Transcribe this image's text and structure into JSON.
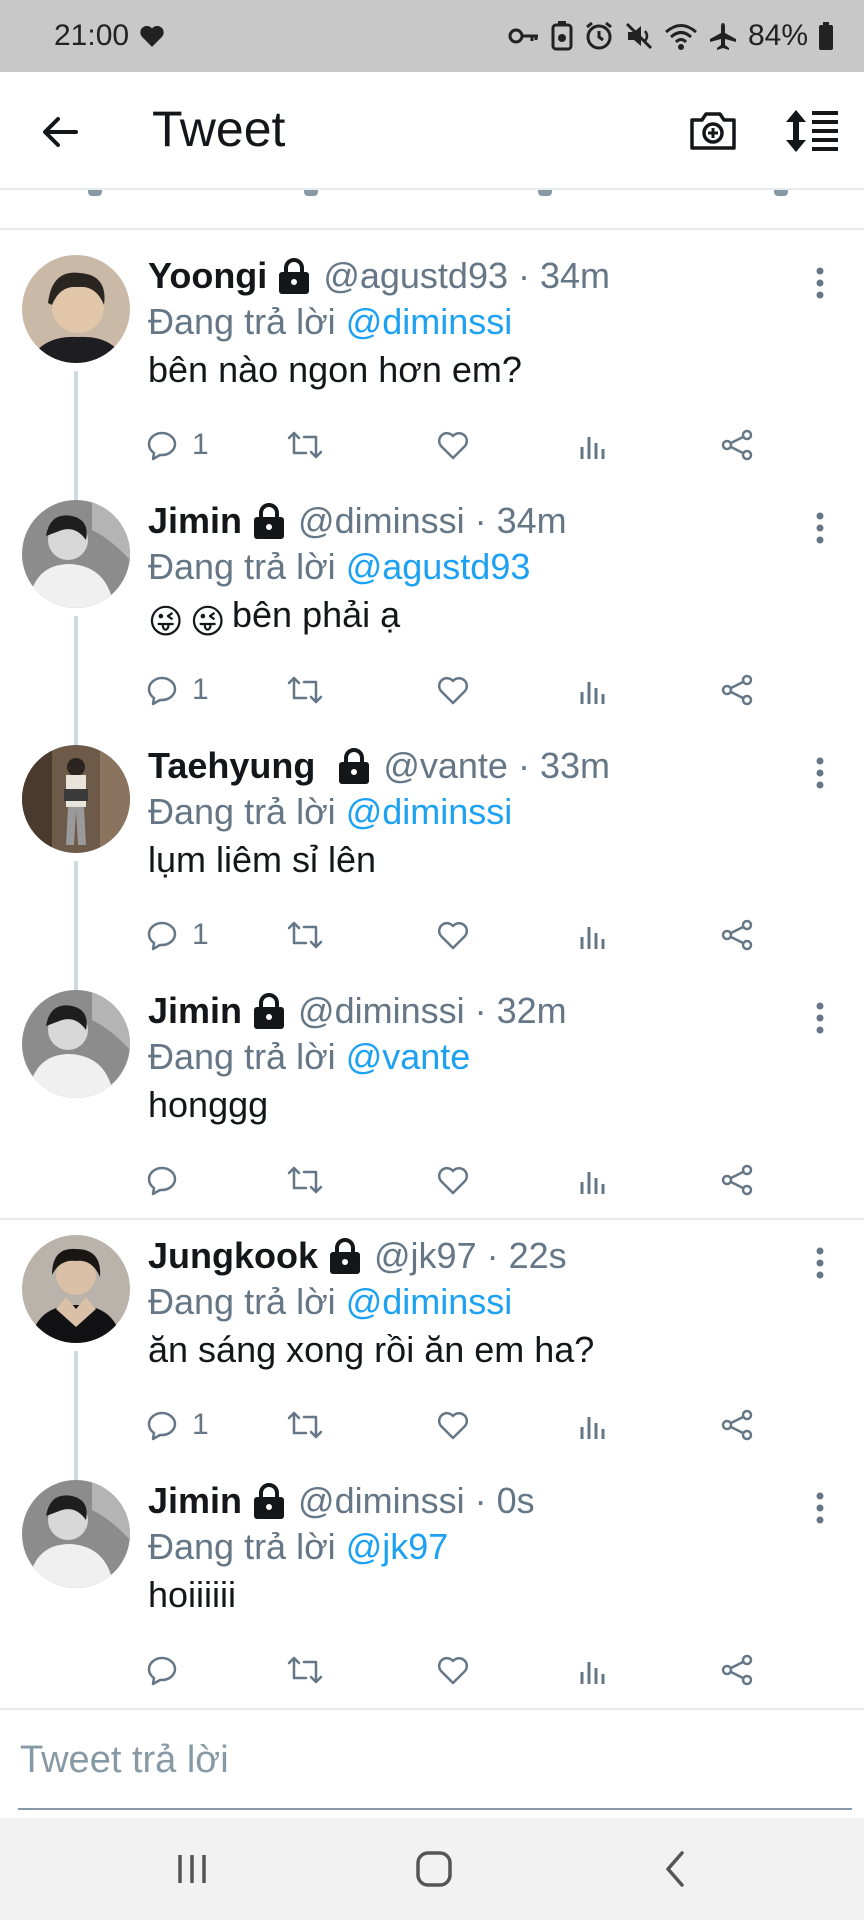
{
  "status_bar": {
    "time": "21:00",
    "battery": "84%",
    "icons": [
      "heart-icon",
      "key-icon",
      "recycle-icon",
      "alarm-icon",
      "mute-icon",
      "wifi-icon",
      "airplane-icon",
      "battery-icon"
    ]
  },
  "header": {
    "title": "Tweet",
    "icons": [
      "back-arrow-icon",
      "camera-plus-icon",
      "sort-icon"
    ]
  },
  "tweets": [
    {
      "name": "Yoongi",
      "handle": "@agustd93 · 34m",
      "reply_prefix": "Đang trả lời ",
      "reply_to": "@diminssi",
      "text": "bên nào ngon hơn em?",
      "reply_count": "1"
    },
    {
      "name": "Jimin",
      "handle": "@diminssi · 34m",
      "reply_prefix": "Đang trả lời ",
      "reply_to": "@agustd93",
      "text": "bên phải ạ",
      "reply_count": "1",
      "emoji": [
        "😜",
        "😜"
      ]
    },
    {
      "name": "Taehyung",
      "handle": "@vante · 33m",
      "reply_prefix": "Đang trả lời ",
      "reply_to": "@diminssi",
      "text": "lụm liêm sỉ lên",
      "reply_count": "1"
    },
    {
      "name": "Jimin",
      "handle": "@diminssi · 32m",
      "reply_prefix": "Đang trả lời ",
      "reply_to": "@vante",
      "text": "honggg",
      "reply_count": ""
    },
    {
      "name": "Jungkook",
      "handle": "@jk97 · 22s",
      "reply_prefix": "Đang trả lời ",
      "reply_to": "@diminssi",
      "text": "ăn sáng xong rồi ăn em ha?",
      "reply_count": "1"
    },
    {
      "name": "Jimin",
      "handle": "@diminssi · 0s",
      "reply_prefix": "Đang trả lời ",
      "reply_to": "@jk97",
      "text": "hoiiiiii",
      "reply_count": ""
    }
  ],
  "compose": {
    "placeholder": "Tweet trả lời"
  },
  "colors": {
    "accent": "#1da1f2",
    "secondary_text": "#657786",
    "status_bar_bg": "#c8c8c8"
  }
}
